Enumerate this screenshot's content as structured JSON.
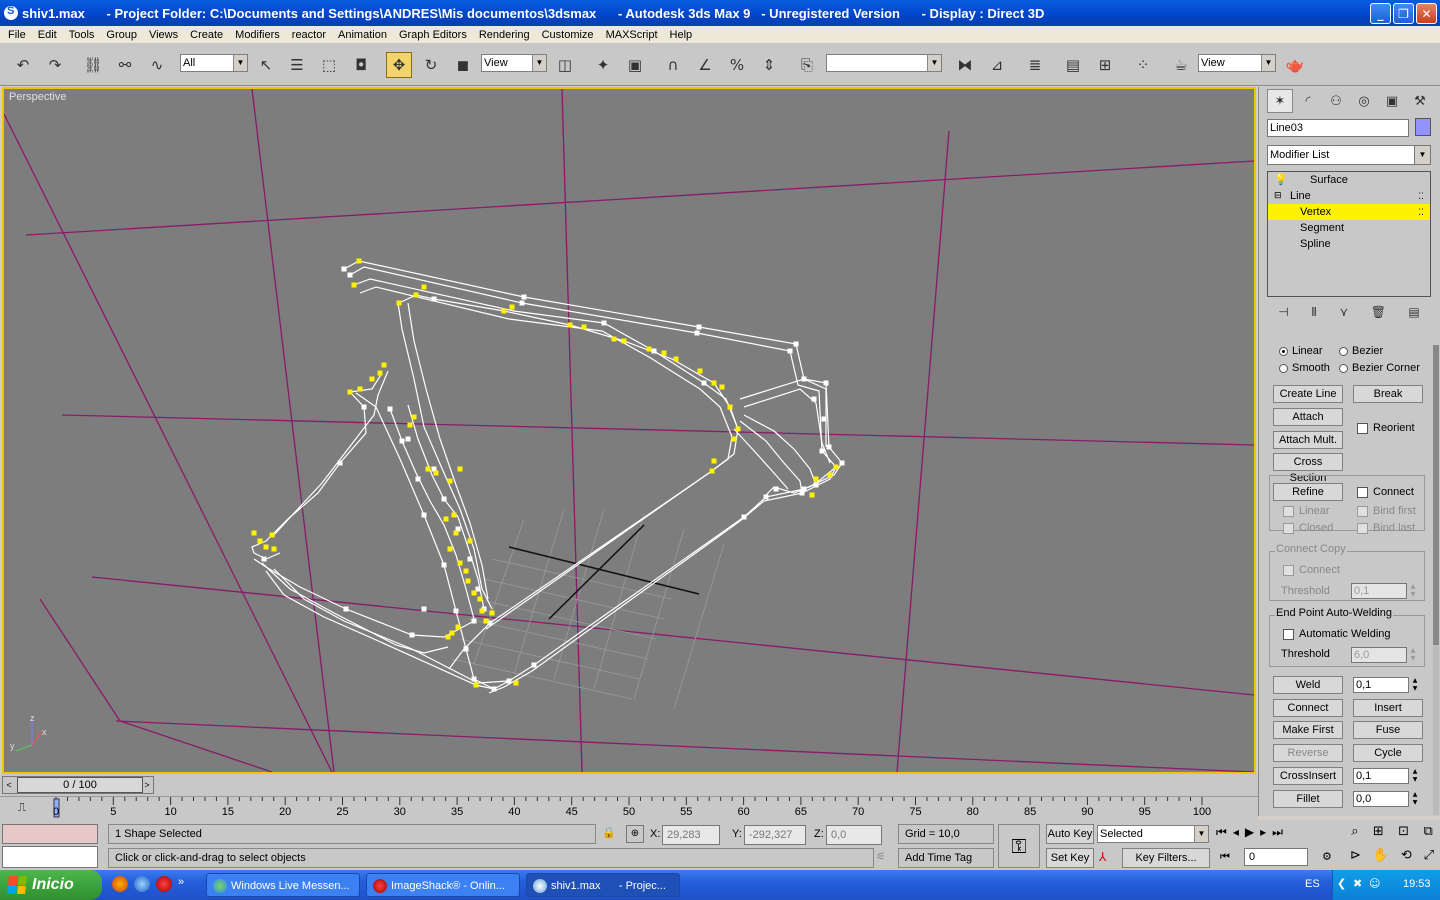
{
  "window": {
    "title": "shiv1.max      - Project Folder: C:\\Documents and Settings\\ANDRES\\Mis documentos\\3dsmax      - Autodesk 3ds Max 9   - Unregistered Version      - Display : Direct 3D",
    "minimize": "_",
    "maximize": "❐",
    "close": "✕"
  },
  "menu": [
    "File",
    "Edit",
    "Tools",
    "Group",
    "Views",
    "Create",
    "Modifiers",
    "reactor",
    "Animation",
    "Graph Editors",
    "Rendering",
    "Customize",
    "MAXScript",
    "Help"
  ],
  "toolbar": {
    "selection_filter": "All",
    "ref_coord": "View",
    "named_selection": "",
    "render_view": "View"
  },
  "viewport": {
    "label": "Perspective",
    "axis_x": "x",
    "axis_y": "y",
    "axis_z": "z"
  },
  "command_panel": {
    "object_name": "Line03",
    "object_color": "#9393ff",
    "modifier_list": "Modifier List",
    "stack": {
      "surface": "Surface",
      "line": "Line",
      "vertex": "Vertex",
      "segment": "Segment",
      "spline": "Spline"
    },
    "rollout": {
      "linear": "Linear",
      "bezier": "Bezier",
      "smooth": "Smooth",
      "bezier_corner": "Bezier Corner",
      "create_line": "Create Line",
      "break": "Break",
      "attach": "Attach",
      "reorient": "Reorient",
      "attach_mult": "Attach Mult.",
      "cross_section": "Cross Section",
      "refine": "Refine",
      "connect": "Connect",
      "refine_linear": "Linear",
      "bind_first": "Bind first",
      "closed": "Closed",
      "bind_last": "Bind last",
      "connect_copy": "Connect Copy",
      "cc_connect": "Connect",
      "threshold": "Threshold",
      "cc_threshold_value": "0,1",
      "endpoint_welding": "End Point Auto-Welding",
      "automatic_welding": "Automatic Welding",
      "ep_threshold_value": "6,0",
      "weld": "Weld",
      "weld_value": "0,1",
      "connect_btn": "Connect",
      "insert": "Insert",
      "make_first": "Make First",
      "fuse": "Fuse",
      "reverse": "Reverse",
      "cycle": "Cycle",
      "cross_insert": "CrossInsert",
      "cross_insert_value": "0,1",
      "fillet": "Fillet",
      "fillet_value": "0,0"
    }
  },
  "timeline": {
    "slider": "0 / 100",
    "ticks": [
      "0",
      "5",
      "10",
      "15",
      "20",
      "25",
      "30",
      "35",
      "40",
      "45",
      "50",
      "55",
      "60",
      "65",
      "70",
      "75",
      "80",
      "85",
      "90",
      "95",
      "100"
    ]
  },
  "status": {
    "selection": "1 Shape Selected",
    "prompt": "Click or click-and-drag to select objects",
    "x_label": "X:",
    "x_value": "29,283",
    "y_label": "Y:",
    "y_value": "-292,327",
    "z_label": "Z:",
    "z_value": "0,0",
    "grid": "Grid = 10,0",
    "add_time_tag": "Add Time Tag",
    "auto_key": "Auto Key",
    "set_key": "Set Key",
    "key_mode": "Selected",
    "key_filters": "Key Filters...",
    "frame": "0"
  },
  "taskbar": {
    "start": "Inicio",
    "tasks": [
      "Windows Live Messen...",
      "ImageShack® - Onlin...",
      "shiv1.max      - Projec..."
    ],
    "lang": "ES",
    "clock": "19:53"
  }
}
